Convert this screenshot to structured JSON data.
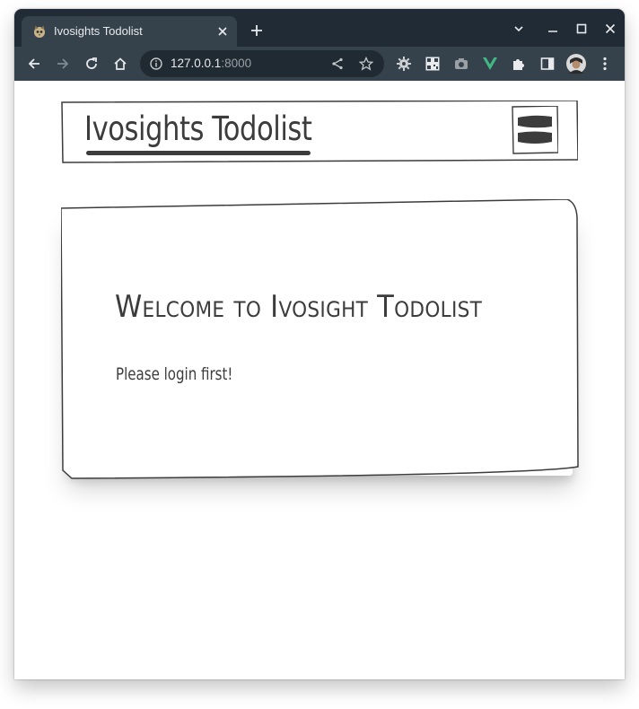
{
  "browser": {
    "tab_title": "Ivosights Todolist",
    "url_host": "127.0.0.1",
    "url_port": ":8000",
    "icons": {
      "favicon": "cat-favicon-icon",
      "close": "close-icon",
      "new_tab": "plus-icon",
      "tab_search": "chevron-down-icon",
      "minimize": "minimize-icon",
      "maximize": "maximize-icon",
      "window_close": "close-icon",
      "back": "arrow-left-icon",
      "forward": "arrow-right-icon",
      "reload": "reload-icon",
      "home": "home-icon",
      "site_info": "info-icon",
      "share": "share-icon",
      "bookmark": "star-icon",
      "extensions": [
        "gear-extension-icon",
        "qr-code-icon",
        "camera-icon",
        "vue-icon",
        "puzzle-icon"
      ],
      "side_panel": "side-panel-icon",
      "profile": "avatar",
      "menu": "kebab-menu-icon"
    },
    "colors": {
      "titlebar": "#202b36",
      "toolbar": "#35424c",
      "omnibox": "#1f2a33",
      "vue_accent": "#41b883"
    }
  },
  "navbar": {
    "brand": "Ivosights Todolist",
    "menu_icon": "hamburger-menu-icon"
  },
  "main": {
    "heading": "Welcome to Ivosight Todolist",
    "message": "Please login first!"
  },
  "colors": {
    "ink": "#3c3c3c",
    "page_bg": "#ffffff"
  }
}
